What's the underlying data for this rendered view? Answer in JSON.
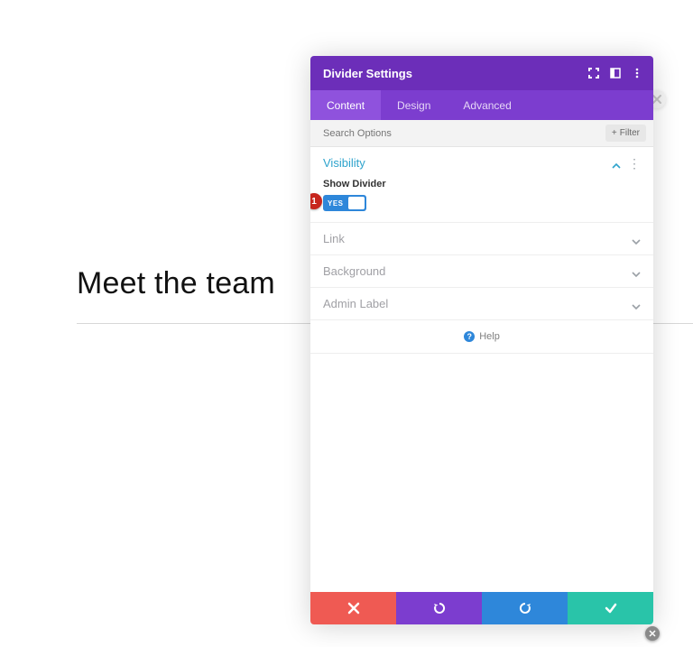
{
  "page": {
    "heading": "Meet the team"
  },
  "modal": {
    "title": "Divider Settings",
    "tabs": {
      "content": "Content",
      "design": "Design",
      "advanced": "Advanced",
      "active": "content"
    },
    "search": {
      "placeholder": "Search Options",
      "filter_label": "Filter"
    },
    "sections": {
      "visibility": {
        "title": "Visibility",
        "field_label": "Show Divider",
        "toggle_value": "YES",
        "marker": "1"
      },
      "link": {
        "title": "Link"
      },
      "background": {
        "title": "Background"
      },
      "admin_label": {
        "title": "Admin Label"
      }
    },
    "help": "Help"
  }
}
